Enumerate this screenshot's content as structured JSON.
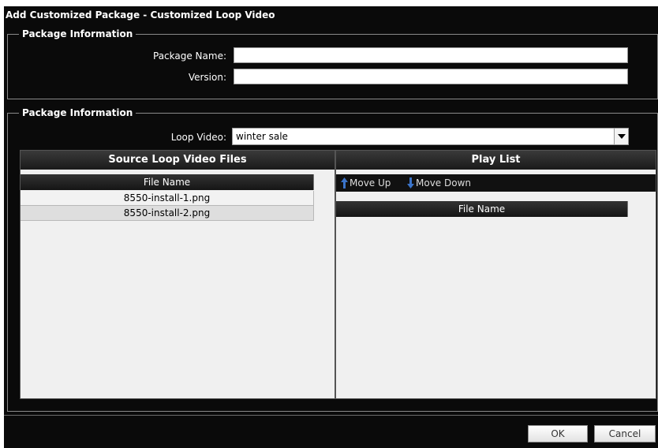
{
  "dialog": {
    "title": "Add Customized Package - Customized Loop Video"
  },
  "package_info": {
    "legend": "Package Information",
    "name_label": "Package Name:",
    "name_value": "",
    "version_label": "Version:",
    "version_value": ""
  },
  "loop_info": {
    "legend": "Package Information",
    "loop_video_label": "Loop Video:",
    "loop_video_value": "winter sale"
  },
  "source_panel": {
    "title": "Source Loop Video Files",
    "column_header": "File Name",
    "rows": [
      "8550-install-1.png",
      "8550-install-2.png"
    ]
  },
  "playlist_panel": {
    "title": "Play List",
    "move_up_label": "Move Up",
    "move_down_label": "Move Down",
    "column_header": "File Name",
    "rows": []
  },
  "footer": {
    "ok_label": "OK",
    "cancel_label": "Cancel"
  },
  "colors": {
    "dialog_bg": "#0a0a0a",
    "panel_bg": "#f0f0f0",
    "arrow_blue": "#3b74c9"
  },
  "icons": [
    "arrow-up-icon",
    "arrow-down-icon",
    "chevron-down-icon"
  ]
}
